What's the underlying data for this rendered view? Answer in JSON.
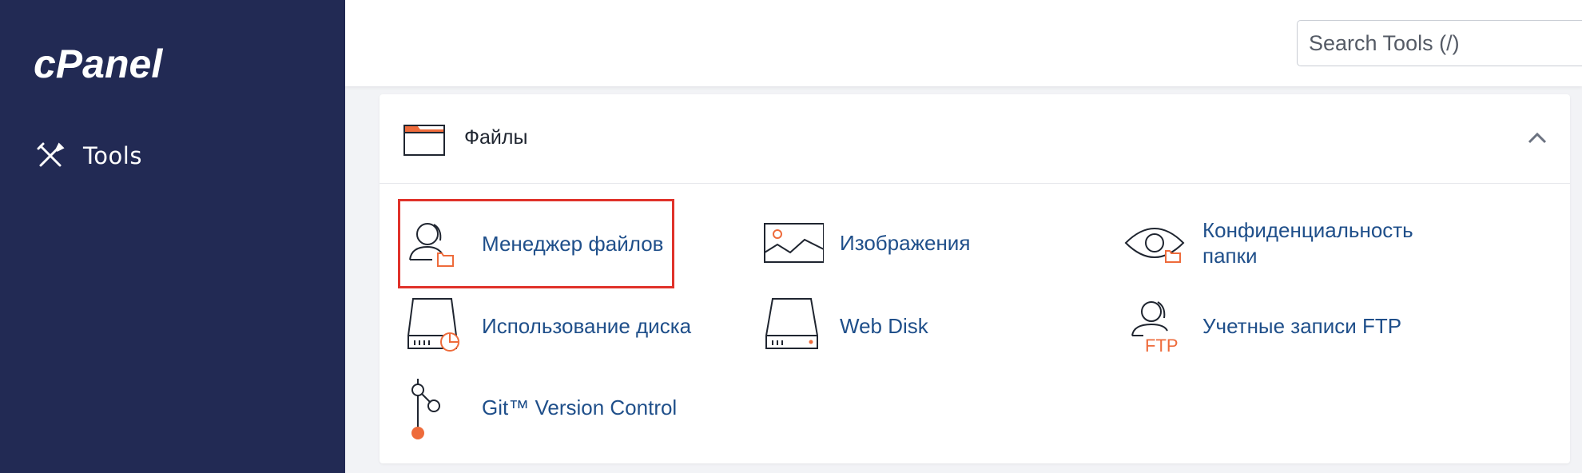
{
  "sidebar": {
    "logo": "cPanel",
    "nav": [
      {
        "label": "Tools",
        "icon": "tools-icon"
      }
    ]
  },
  "header": {
    "search": {
      "placeholder": "Search Tools (/)",
      "value": ""
    }
  },
  "section": {
    "title": "Файлы",
    "icon": "folder-icon",
    "expanded": true,
    "accent_color": "#ee6b3b",
    "link_color": "#1f4f8a",
    "highlight_color": "#e0322a",
    "tools": [
      {
        "label": "Менеджер файлов",
        "icon": "file-manager-icon",
        "highlighted": true
      },
      {
        "label": "Изображения",
        "icon": "images-icon"
      },
      {
        "label_line1": "Конфиденциальность",
        "label_line2": "папки",
        "icon": "directory-privacy-icon"
      },
      {
        "label": "Использование диска",
        "icon": "disk-usage-icon"
      },
      {
        "label": "Web Disk",
        "icon": "web-disk-icon"
      },
      {
        "label": "Учетные записи FTP",
        "icon": "ftp-accounts-icon",
        "icon_text": "FTP"
      },
      {
        "label": "Git™ Version Control",
        "icon": "git-version-control-icon"
      }
    ]
  }
}
